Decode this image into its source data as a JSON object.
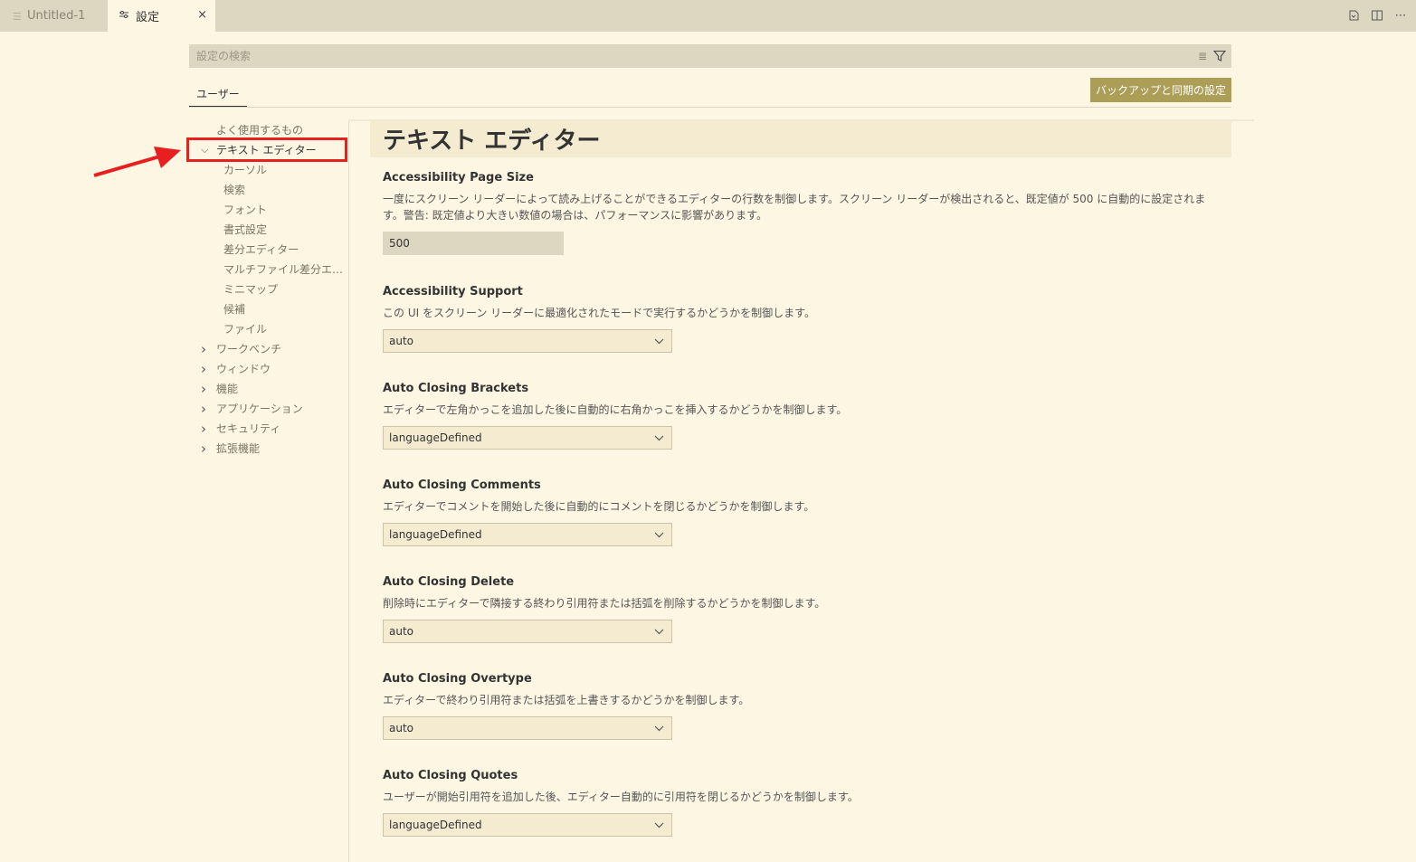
{
  "tabs": {
    "untitled_label": "Untitled-1",
    "settings_label": "設定",
    "close_glyph": "×"
  },
  "search": {
    "placeholder": "設定の検索"
  },
  "scope": {
    "user_label": "ユーザー",
    "sync_label": "バックアップと同期の設定"
  },
  "toc": {
    "items": [
      {
        "label": "よく使用するもの",
        "level": 0,
        "expanded": null
      },
      {
        "label": "テキスト エディター",
        "level": 0,
        "expanded": true
      },
      {
        "label": "カーソル",
        "level": 1
      },
      {
        "label": "検索",
        "level": 1
      },
      {
        "label": "フォント",
        "level": 1
      },
      {
        "label": "書式設定",
        "level": 1
      },
      {
        "label": "差分エディター",
        "level": 1
      },
      {
        "label": "マルチファイル差分エディ...",
        "level": 1
      },
      {
        "label": "ミニマップ",
        "level": 1
      },
      {
        "label": "候補",
        "level": 1
      },
      {
        "label": "ファイル",
        "level": 1
      },
      {
        "label": "ワークベンチ",
        "level": 0,
        "expanded": false
      },
      {
        "label": "ウィンドウ",
        "level": 0,
        "expanded": false
      },
      {
        "label": "機能",
        "level": 0,
        "expanded": false
      },
      {
        "label": "アプリケーション",
        "level": 0,
        "expanded": false
      },
      {
        "label": "セキュリティ",
        "level": 0,
        "expanded": false
      },
      {
        "label": "拡張機能",
        "level": 0,
        "expanded": false
      }
    ]
  },
  "section": {
    "title": "テキスト エディター"
  },
  "settings": [
    {
      "title": "Accessibility Page Size",
      "desc": "一度にスクリーン リーダーによって読み上げることができるエディターの行数を制御します。スクリーン リーダーが検出されると、既定値が 500 に自動的に設定されます。警告: 既定値より大きい数値の場合は、パフォーマンスに影響があります。",
      "type": "number",
      "value": "500"
    },
    {
      "title": "Accessibility Support",
      "desc": "この UI をスクリーン リーダーに最適化されたモードで実行するかどうかを制御します。",
      "type": "select",
      "value": "auto"
    },
    {
      "title": "Auto Closing Brackets",
      "desc": "エディターで左角かっこを追加した後に自動的に右角かっこを挿入するかどうかを制御します。",
      "type": "select",
      "value": "languageDefined"
    },
    {
      "title": "Auto Closing Comments",
      "desc": "エディターでコメントを開始した後に自動的にコメントを閉じるかどうかを制御します。",
      "type": "select",
      "value": "languageDefined"
    },
    {
      "title": "Auto Closing Delete",
      "desc": "削除時にエディターで隣接する終わり引用符または括弧を削除するかどうかを制御します。",
      "type": "select",
      "value": "auto"
    },
    {
      "title": "Auto Closing Overtype",
      "desc": "エディターで終わり引用符または括弧を上書きするかどうかを制御します。",
      "type": "select",
      "value": "auto"
    },
    {
      "title": "Auto Closing Quotes",
      "desc": "ユーザーが開始引用符を追加した後、エディター自動的に引用符を閉じるかどうかを制御します。",
      "type": "select",
      "value": "languageDefined"
    }
  ],
  "colors": {
    "background": "#fdf6e3",
    "tabbar": "#ddd6c1",
    "accent_button": "#ac9d57",
    "highlight": "#e81f1f"
  }
}
